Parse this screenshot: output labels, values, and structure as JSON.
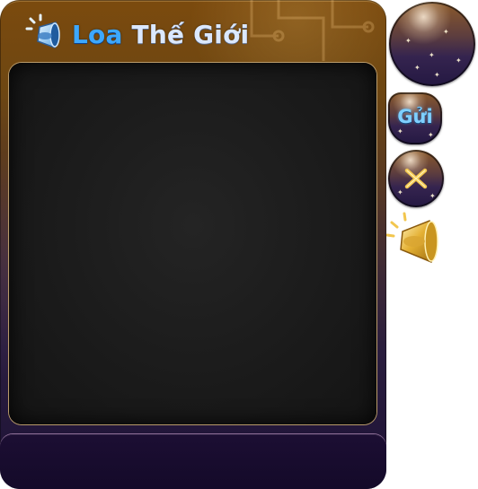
{
  "window": {
    "title_part1": "Loa",
    "title_part2": "Thế Giới"
  },
  "buttons": {
    "send_label": "Gửi"
  },
  "icons": {
    "header": "megaphone-icon",
    "close": "close-icon",
    "side": "megaphone-icon"
  },
  "colors": {
    "header_gold": "#7b4a0e",
    "panel_purple": "#1d1236",
    "title_blue": "#3da8ff",
    "send_text": "#7fd0ff",
    "close_gold": "#e8b83e"
  }
}
